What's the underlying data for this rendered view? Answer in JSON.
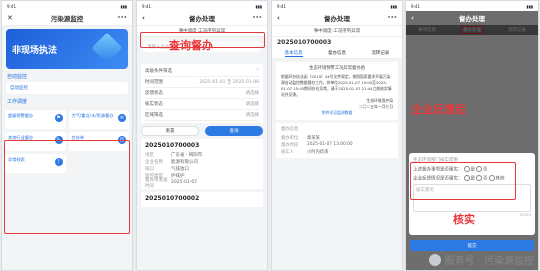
{
  "panel1": {
    "title": "污染源监控",
    "banner": "非现场执法",
    "section_auto": "自动监控",
    "auto_item": "自动监控",
    "section_work": "工作调度",
    "items": [
      {
        "label": "超级预警督办",
        "icon": "⚑"
      },
      {
        "label": "大气/重点/水/资源督办",
        "icon": "≡"
      },
      {
        "label": "其他行业督办",
        "icon": "✎"
      },
      {
        "label": "交办单",
        "icon": "▤"
      },
      {
        "label": "异常线索",
        "icon": "!"
      }
    ]
  },
  "panel2": {
    "title": "督办处理",
    "subtitle": "事中调度-工况序列异常",
    "annotation": "查询督办",
    "search_placeholder": "请输入企业名称",
    "filter_title": "高级条件筛选",
    "filters": [
      {
        "k": "时间范围",
        "v": "2025-01-01 至 2025-01-08"
      },
      {
        "k": "反馈状态",
        "v": "请选择"
      },
      {
        "k": "核实状态",
        "v": "请选择"
      },
      {
        "k": "区域筛选",
        "v": "请选择"
      }
    ],
    "btn_reset": "重置",
    "btn_query": "查询",
    "record_no": "2025010700003",
    "record_fields": [
      {
        "k": "地区",
        "v": "广东省 · 揭阳市"
      },
      {
        "k": "企业名称",
        "v": "能源有限公司"
      },
      {
        "k": "排口",
        "v": "气排放口"
      },
      {
        "k": "监控类型",
        "v": "护排护"
      },
      {
        "k": "督办单发送时间",
        "v": "2025-01-07"
      }
    ],
    "record_no2": "2025010700002"
  },
  "panel3": {
    "title": "督办处理",
    "subtitle": "事中调度-工况序列异常",
    "record_no": "2025010700003",
    "tabs": [
      "基本信息",
      "督办信息",
      "流转记录"
    ],
    "doc_title": "生态环境预警工况异常督办函",
    "doc_body": "根据环办执法函〔2019〕44号文件规定，按照国家要求开展污染源自动监控数据督办工作，你单位2025-01-07 15:00至2025-01-07 15:45期间存在异常，请于2025-01-07 21:44之前核实情况并反馈。",
    "doc_sign": "生态环境保护局",
    "doc_date": "二〇二五年一月七日",
    "doc_link": "附件详见监测数据",
    "section": "督办信息",
    "fields": [
      {
        "k": "督办单位",
        "v": "章某某"
      },
      {
        "k": "督办时间",
        "v": "2025-01-07 13:00:00"
      },
      {
        "k": "核实人",
        "v": "小时内结束"
      }
    ]
  },
  "panel4": {
    "title": "督办处理",
    "tabs": [
      "事项信息",
      "督办处理",
      "流转记录"
    ],
    "annotation_top": "企业反馈后",
    "modal_header": "生态环境部门核实结果",
    "q1": "上述督办事项是否属实：",
    "q2": "企业反馈情况是否属实：",
    "opt_yes": "是",
    "opt_no": "否",
    "opt_other": "其他",
    "remark_placeholder": "核实意见",
    "counter": "0/150",
    "annotation_bottom": "核实",
    "submit": "提交"
  },
  "watermark": "服务号 · 污染源监控",
  "colors": {
    "accent": "#1f6fe0",
    "annotation": "#e8373c"
  }
}
